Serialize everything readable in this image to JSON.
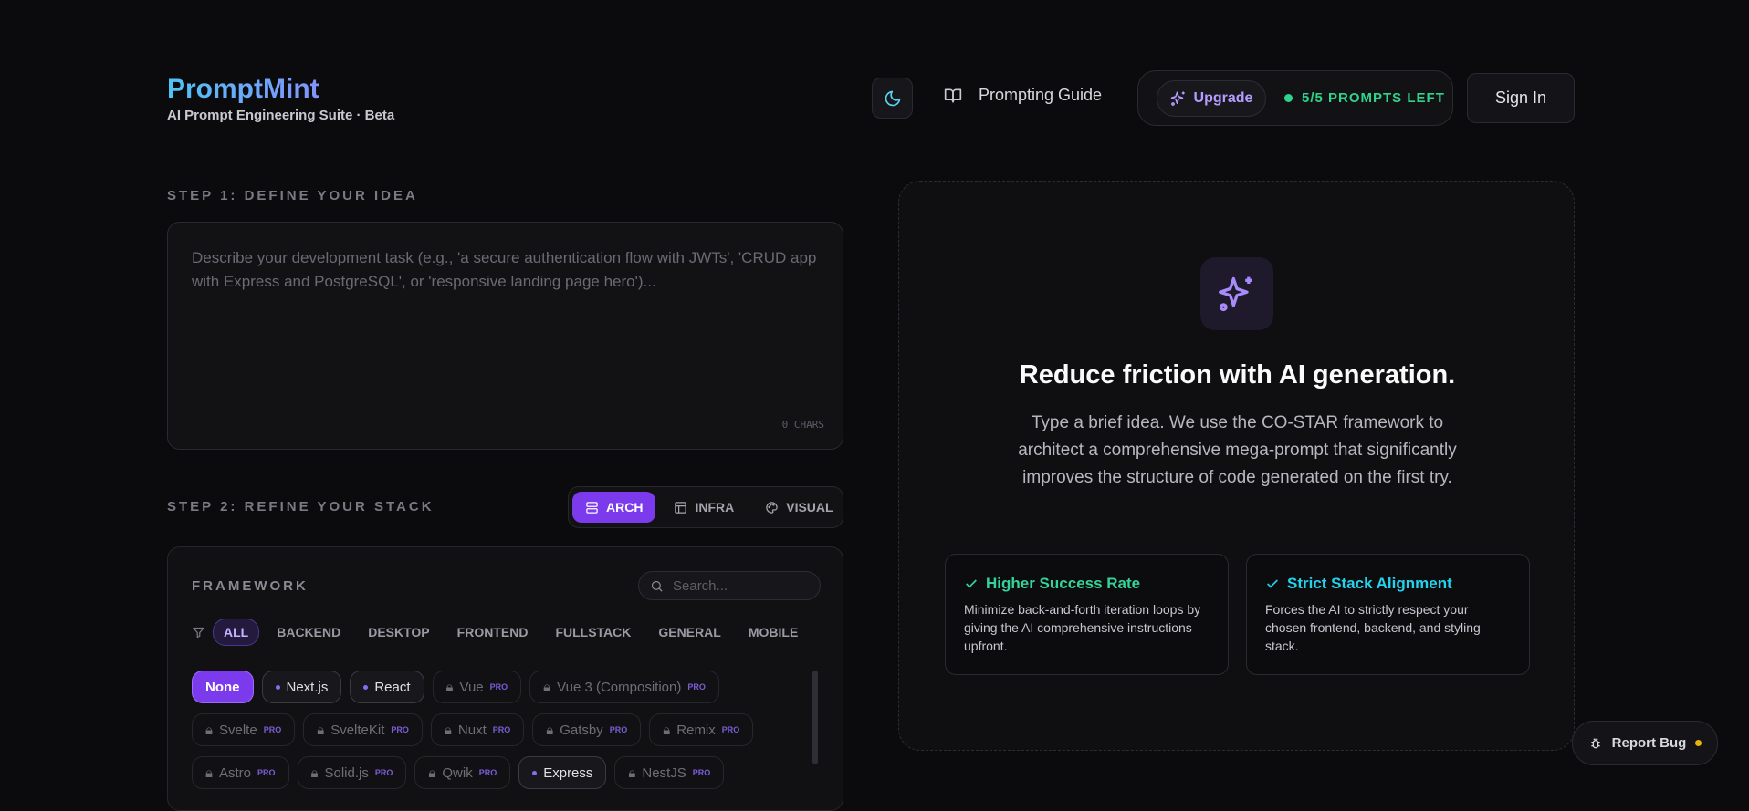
{
  "header": {
    "brand_title": "PromptMint",
    "brand_subtitle": "AI Prompt Engineering Suite · Beta",
    "guide_label": "Prompting Guide",
    "upgrade_label": "Upgrade",
    "prompts_left": "5/5 PROMPTS LEFT",
    "signin_label": "Sign In"
  },
  "step1": {
    "label": "STEP 1: DEFINE YOUR IDEA",
    "placeholder": "Describe your development task (e.g., 'a secure authentication flow with JWTs', 'CRUD app with Express and PostgreSQL', or 'responsive landing page hero')...",
    "chars": "0 CHARS"
  },
  "step2": {
    "label": "STEP 2: REFINE YOUR STACK",
    "tabs": [
      "ARCH",
      "INFRA",
      "VISUAL"
    ],
    "framework_label": "FRAMEWORK",
    "search_placeholder": "Search...",
    "filters": [
      "ALL",
      "BACKEND",
      "DESKTOP",
      "FRONTEND",
      "FULLSTACK",
      "GENERAL",
      "MOBILE"
    ],
    "pro_badge": "PRO",
    "chips": {
      "none": "None",
      "nextjs": "Next.js",
      "react": "React",
      "vue": "Vue",
      "vue3": "Vue 3 (Composition)",
      "svelte": "Svelte",
      "sveltekit": "SvelteKit",
      "nuxt": "Nuxt",
      "gatsby": "Gatsby",
      "remix": "Remix",
      "astro": "Astro",
      "solid": "Solid.js",
      "qwik": "Qwik",
      "express": "Express",
      "nestjs": "NestJS"
    }
  },
  "hero": {
    "title": "Reduce friction with AI generation.",
    "body": "Type a brief idea. We use the CO-STAR framework to architect a comprehensive mega-prompt that significantly improves the structure of code generated on the first try.",
    "cards": [
      {
        "title": "Higher Success Rate",
        "body": "Minimize back-and-forth iteration loops by giving the AI comprehensive instructions upfront.",
        "color": "#34d399"
      },
      {
        "title": "Strict Stack Alignment",
        "body": "Forces the AI to strictly respect your chosen frontend, backend, and styling stack.",
        "color": "#22d3ee"
      }
    ]
  },
  "report_bug": "Report Bug",
  "colors": {
    "accent": "#7c3aed",
    "green": "#2fd38b",
    "amber": "#eab308"
  }
}
